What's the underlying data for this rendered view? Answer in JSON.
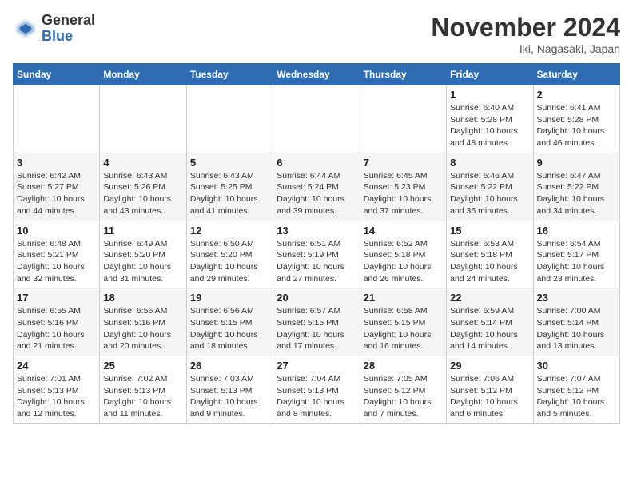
{
  "header": {
    "logo_general": "General",
    "logo_blue": "Blue",
    "month_title": "November 2024",
    "location": "Iki, Nagasaki, Japan"
  },
  "weekdays": [
    "Sunday",
    "Monday",
    "Tuesday",
    "Wednesday",
    "Thursday",
    "Friday",
    "Saturday"
  ],
  "weeks": [
    [
      {
        "day": "",
        "info": ""
      },
      {
        "day": "",
        "info": ""
      },
      {
        "day": "",
        "info": ""
      },
      {
        "day": "",
        "info": ""
      },
      {
        "day": "",
        "info": ""
      },
      {
        "day": "1",
        "info": "Sunrise: 6:40 AM\nSunset: 5:28 PM\nDaylight: 10 hours\nand 48 minutes."
      },
      {
        "day": "2",
        "info": "Sunrise: 6:41 AM\nSunset: 5:28 PM\nDaylight: 10 hours\nand 46 minutes."
      }
    ],
    [
      {
        "day": "3",
        "info": "Sunrise: 6:42 AM\nSunset: 5:27 PM\nDaylight: 10 hours\nand 44 minutes."
      },
      {
        "day": "4",
        "info": "Sunrise: 6:43 AM\nSunset: 5:26 PM\nDaylight: 10 hours\nand 43 minutes."
      },
      {
        "day": "5",
        "info": "Sunrise: 6:43 AM\nSunset: 5:25 PM\nDaylight: 10 hours\nand 41 minutes."
      },
      {
        "day": "6",
        "info": "Sunrise: 6:44 AM\nSunset: 5:24 PM\nDaylight: 10 hours\nand 39 minutes."
      },
      {
        "day": "7",
        "info": "Sunrise: 6:45 AM\nSunset: 5:23 PM\nDaylight: 10 hours\nand 37 minutes."
      },
      {
        "day": "8",
        "info": "Sunrise: 6:46 AM\nSunset: 5:22 PM\nDaylight: 10 hours\nand 36 minutes."
      },
      {
        "day": "9",
        "info": "Sunrise: 6:47 AM\nSunset: 5:22 PM\nDaylight: 10 hours\nand 34 minutes."
      }
    ],
    [
      {
        "day": "10",
        "info": "Sunrise: 6:48 AM\nSunset: 5:21 PM\nDaylight: 10 hours\nand 32 minutes."
      },
      {
        "day": "11",
        "info": "Sunrise: 6:49 AM\nSunset: 5:20 PM\nDaylight: 10 hours\nand 31 minutes."
      },
      {
        "day": "12",
        "info": "Sunrise: 6:50 AM\nSunset: 5:20 PM\nDaylight: 10 hours\nand 29 minutes."
      },
      {
        "day": "13",
        "info": "Sunrise: 6:51 AM\nSunset: 5:19 PM\nDaylight: 10 hours\nand 27 minutes."
      },
      {
        "day": "14",
        "info": "Sunrise: 6:52 AM\nSunset: 5:18 PM\nDaylight: 10 hours\nand 26 minutes."
      },
      {
        "day": "15",
        "info": "Sunrise: 6:53 AM\nSunset: 5:18 PM\nDaylight: 10 hours\nand 24 minutes."
      },
      {
        "day": "16",
        "info": "Sunrise: 6:54 AM\nSunset: 5:17 PM\nDaylight: 10 hours\nand 23 minutes."
      }
    ],
    [
      {
        "day": "17",
        "info": "Sunrise: 6:55 AM\nSunset: 5:16 PM\nDaylight: 10 hours\nand 21 minutes."
      },
      {
        "day": "18",
        "info": "Sunrise: 6:56 AM\nSunset: 5:16 PM\nDaylight: 10 hours\nand 20 minutes."
      },
      {
        "day": "19",
        "info": "Sunrise: 6:56 AM\nSunset: 5:15 PM\nDaylight: 10 hours\nand 18 minutes."
      },
      {
        "day": "20",
        "info": "Sunrise: 6:57 AM\nSunset: 5:15 PM\nDaylight: 10 hours\nand 17 minutes."
      },
      {
        "day": "21",
        "info": "Sunrise: 6:58 AM\nSunset: 5:15 PM\nDaylight: 10 hours\nand 16 minutes."
      },
      {
        "day": "22",
        "info": "Sunrise: 6:59 AM\nSunset: 5:14 PM\nDaylight: 10 hours\nand 14 minutes."
      },
      {
        "day": "23",
        "info": "Sunrise: 7:00 AM\nSunset: 5:14 PM\nDaylight: 10 hours\nand 13 minutes."
      }
    ],
    [
      {
        "day": "24",
        "info": "Sunrise: 7:01 AM\nSunset: 5:13 PM\nDaylight: 10 hours\nand 12 minutes."
      },
      {
        "day": "25",
        "info": "Sunrise: 7:02 AM\nSunset: 5:13 PM\nDaylight: 10 hours\nand 11 minutes."
      },
      {
        "day": "26",
        "info": "Sunrise: 7:03 AM\nSunset: 5:13 PM\nDaylight: 10 hours\nand 9 minutes."
      },
      {
        "day": "27",
        "info": "Sunrise: 7:04 AM\nSunset: 5:13 PM\nDaylight: 10 hours\nand 8 minutes."
      },
      {
        "day": "28",
        "info": "Sunrise: 7:05 AM\nSunset: 5:12 PM\nDaylight: 10 hours\nand 7 minutes."
      },
      {
        "day": "29",
        "info": "Sunrise: 7:06 AM\nSunset: 5:12 PM\nDaylight: 10 hours\nand 6 minutes."
      },
      {
        "day": "30",
        "info": "Sunrise: 7:07 AM\nSunset: 5:12 PM\nDaylight: 10 hours\nand 5 minutes."
      }
    ]
  ]
}
